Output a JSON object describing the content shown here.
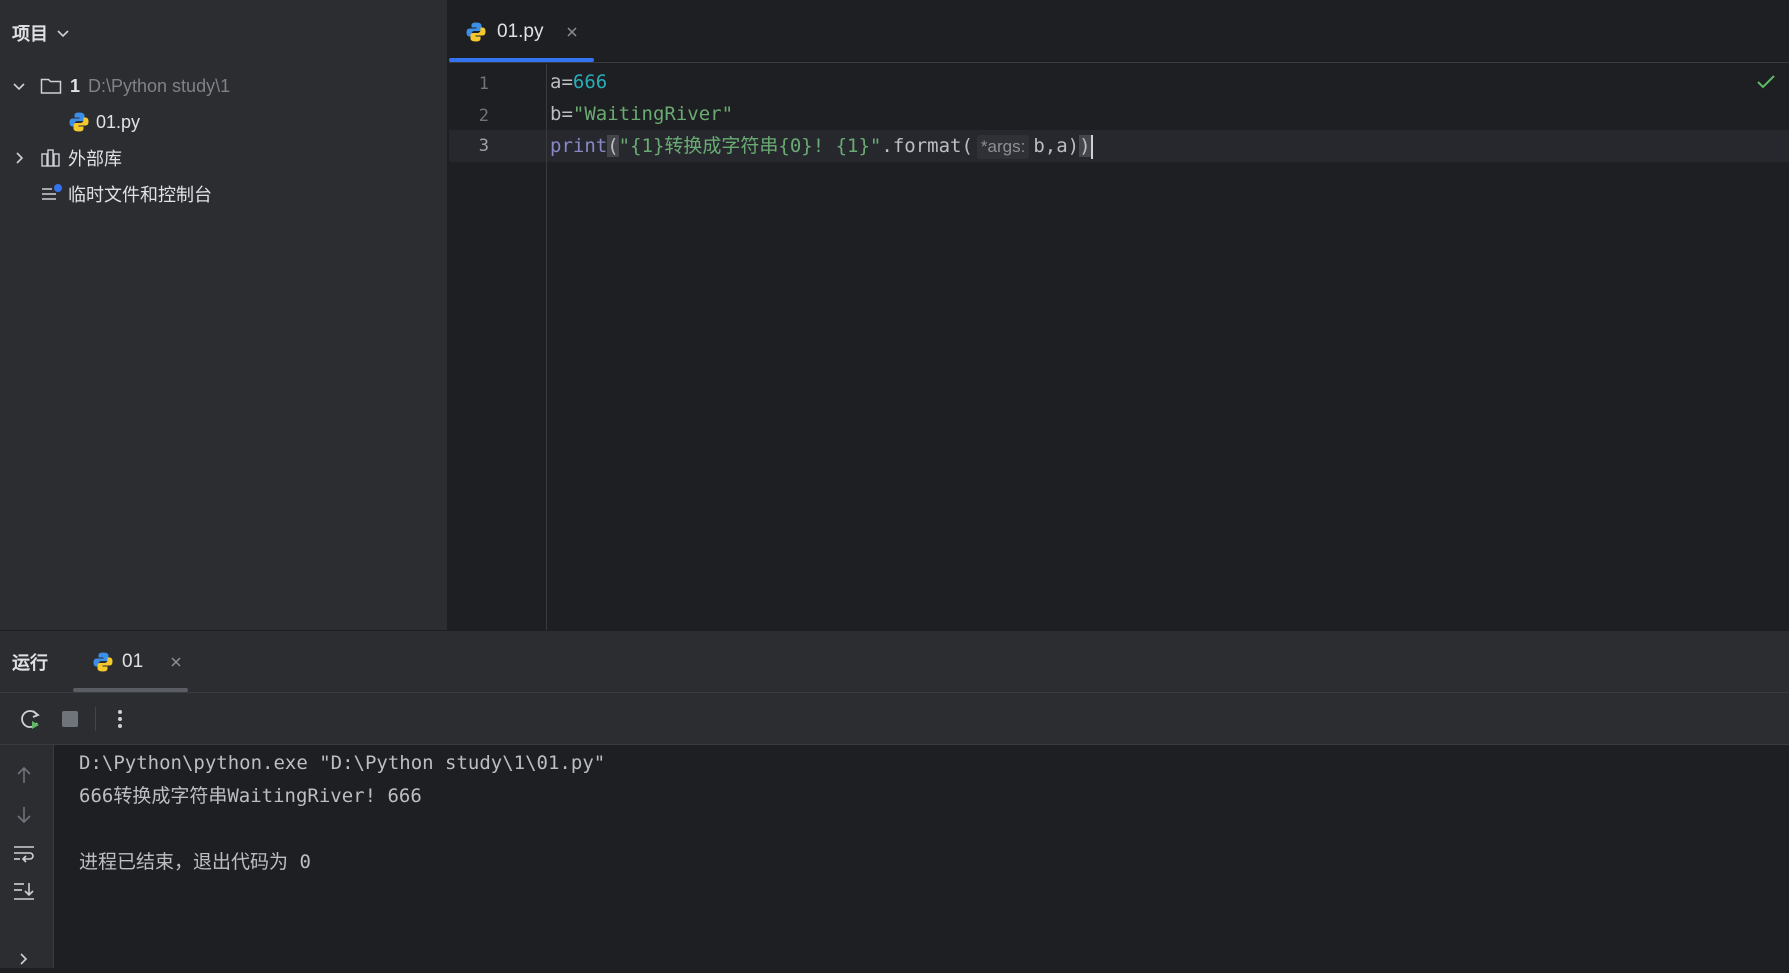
{
  "project": {
    "header": "项目",
    "tree": {
      "root_name": "1",
      "root_path": "D:\\Python study\\1",
      "file": "01.py",
      "external_libs": "外部库",
      "scratches": "临时文件和控制台"
    }
  },
  "editor": {
    "tab": "01.py",
    "line_numbers": [
      "1",
      "2",
      "3"
    ],
    "lines": {
      "l1": {
        "var": "a=",
        "num": "666"
      },
      "l2": {
        "var": "b=",
        "str": "\"WaitingRiver\""
      },
      "l3": {
        "fn": "print",
        "open": "(",
        "str": "\"{1}转换成字符串{0}! {1}\"",
        "method": ".format(",
        "hint": "*args:",
        "args": "b,a)",
        "close": ")"
      }
    }
  },
  "run": {
    "title": "运行",
    "tab": "01",
    "console": [
      "D:\\Python\\python.exe \"D:\\Python study\\1\\01.py\"",
      "666转换成字符串WaitingRiver! 666",
      "",
      "进程已结束，退出代码为 0"
    ]
  },
  "colors": {
    "accent": "#3574f0",
    "string": "#6aab73",
    "number": "#2aacb8",
    "builtin": "#8888c6",
    "success": "#5fb865"
  }
}
